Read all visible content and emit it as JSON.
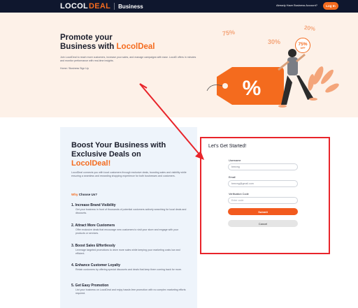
{
  "header": {
    "brand_part1": "LOCOL",
    "brand_part2": "DEAL",
    "brand_suffix": "Business",
    "account_prompt": "Already Have Business Account?",
    "login_label": "Log In"
  },
  "hero": {
    "title_line1": "Promote your",
    "title_line2_prefix": "Business with ",
    "title_line2_accent": "LocolDeal",
    "description": "Join LocolDeal to reach more customers, increase your sales, and manage campaigns with ease. LocolD offers in minutes and monitor performance with real-time insights.",
    "breadcrumb": "Home / Business Sign Up",
    "discounts": [
      "75%",
      "30%",
      "20%"
    ],
    "badge_value": "75%",
    "badge_text": "OFF",
    "tag_symbol": "%"
  },
  "benefits": {
    "title_line1": "Boost Your Business with",
    "title_line2": "Exclusive Deals on",
    "title_accent": "LocolDeal!",
    "description": "LocolDeal connects you with local customers through exclusive deals, boosting sales and visibility while ensuring a seamless and rewarding shopping experience for both businesses and customers.",
    "why_accent": "Why",
    "why_rest": " Choose Us?",
    "features": [
      {
        "title": "1. Increase Brand Visibility",
        "desc": "Get your business in front of thousands of potential customers actively searching for local deals and discounts."
      },
      {
        "title": "2. Attract More Customers",
        "desc": "Offer exclusive deals that encourage new customers to visit your store and engage with your products or services."
      },
      {
        "title": "3. Boost Sales Effortlessly",
        "desc": "Leverage targeted promotions to drive more sales while keeping your marketing costs low and efficient."
      },
      {
        "title": "4. Enhance Customer Loyalty",
        "desc": "Retain customers by offering special discounts and deals that keep them coming back for more."
      },
      {
        "title": "5. Get Easy Promotion",
        "desc": "List your business on LocolDeal and enjoy hassle-free promotion with no complex marketing efforts required."
      }
    ]
  },
  "form": {
    "title": "Let's Get Started!",
    "username_label": "Username",
    "username_value": "beezng",
    "email_label": "Email",
    "email_value": "beezng@gmail.com",
    "code_label": "Verification Code",
    "code_placeholder": "Enter code",
    "submit_label": "Submit",
    "cancel_label": "Cancel"
  },
  "colors": {
    "accent": "#f46b1e",
    "header_bg": "#0f172e",
    "hero_bg": "#fdf1e8",
    "highlight_border": "#e8242a"
  }
}
